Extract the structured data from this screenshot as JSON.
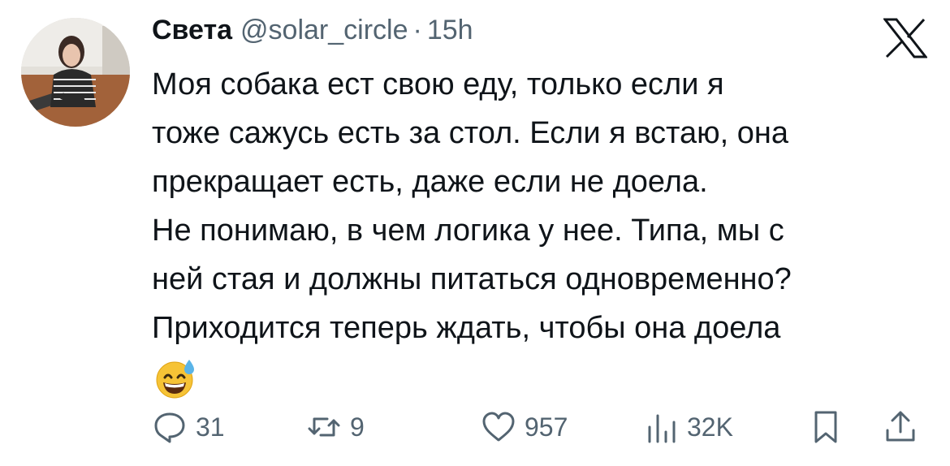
{
  "tweet": {
    "display_name": "Света",
    "handle": "@solar_circle",
    "separator": "·",
    "time": "15h",
    "text": "Моя собака ест свою еду, только если я\nтоже сажусь есть за стол. Если я встаю, она\nпрекращает есть, даже если не доела.\nНе понимаю, в чем логика у нее. Типа, мы с\nней стая и должны питаться одновременно?\nПриходится теперь ждать, чтобы она доела"
  },
  "actions": {
    "replies": "31",
    "retweets": "9",
    "likes": "957",
    "views": "32K"
  },
  "icons": {
    "platform": "x-logo-icon",
    "emoji": "grinning-face-with-sweat-emoji",
    "reply": "reply-icon",
    "retweet": "retweet-icon",
    "like": "heart-icon",
    "views": "views-icon",
    "bookmark": "bookmark-icon",
    "share": "share-icon"
  },
  "colors": {
    "text": "#0f1419",
    "secondary": "#536471",
    "background": "#ffffff"
  }
}
